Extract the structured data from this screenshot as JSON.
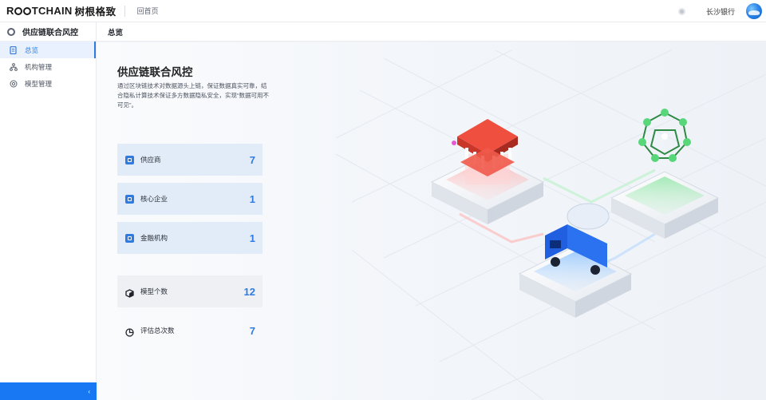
{
  "header": {
    "logo_prefix": "R",
    "logo_after_rings": "TCHAIN",
    "logo_tail": "树根格致",
    "home_link": "回首页",
    "bank_name": "长沙银行"
  },
  "sidebar": {
    "title": "供应链联合风控",
    "items": [
      {
        "label": "总览",
        "icon": "document-icon",
        "active": true
      },
      {
        "label": "机构管理",
        "icon": "org-tree-icon",
        "active": false
      },
      {
        "label": "模型管理",
        "icon": "model-target-icon",
        "active": false
      }
    ],
    "collapse_icon": "chevron-left-icon"
  },
  "breadcrumb": {
    "current": "总览"
  },
  "overview": {
    "title": "供应链联合风控",
    "description": "通过区块链技术对数据源头上链，保证数据真实可靠，结合隐私计算技术保证多方数据隐私安全，实现“数据可用不可见”。",
    "stats": [
      {
        "label": "供应商",
        "value": "7",
        "icon": "supplier-icon"
      },
      {
        "label": "核心企业",
        "value": "1",
        "icon": "core-enterprise-icon"
      },
      {
        "label": "金融机构",
        "value": "1",
        "icon": "bank-icon"
      },
      {
        "label": "模型个数",
        "value": "12",
        "icon": "cube-icon"
      },
      {
        "label": "评估总次数",
        "value": "7",
        "icon": "pie-icon"
      }
    ]
  },
  "colors": {
    "accent": "#2f7be0",
    "collapse_bar": "#1877f2",
    "stat_card_bg": "#e2ecf8"
  }
}
